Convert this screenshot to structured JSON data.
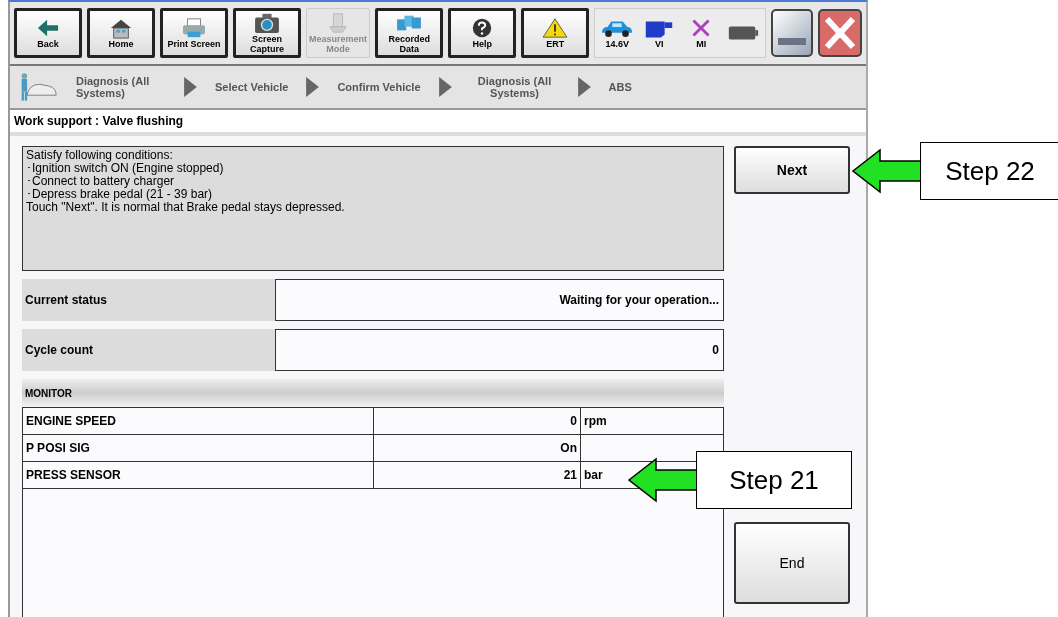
{
  "toolbar": {
    "buttons": [
      {
        "kind": "back",
        "label": "Back",
        "disabled": false
      },
      {
        "kind": "home",
        "label": "Home",
        "disabled": false
      },
      {
        "kind": "printer",
        "label": "Print Screen",
        "disabled": false
      },
      {
        "kind": "camera",
        "label": "Screen Capture",
        "disabled": false
      },
      {
        "kind": "meter",
        "label": "Measurement Mode",
        "disabled": true
      },
      {
        "kind": "folders",
        "label": "Recorded Data",
        "disabled": false
      },
      {
        "kind": "help",
        "label": "Help",
        "disabled": false
      },
      {
        "kind": "warning",
        "label": "ERT",
        "disabled": false
      }
    ],
    "status": [
      {
        "kind": "car",
        "label": "14.6V"
      },
      {
        "kind": "vi",
        "label": "VI"
      },
      {
        "kind": "mi",
        "label": "MI"
      },
      {
        "kind": "battery"
      }
    ]
  },
  "breadcrumb": [
    "Diagnosis (All Systems)",
    "Select Vehicle",
    "Confirm Vehicle",
    "Diagnosis (All Systems)",
    "ABS"
  ],
  "page_title": "Work support : Valve flushing",
  "instructions": [
    "Satisfy following conditions:",
    "･Ignition switch ON (Engine stopped)",
    "･Connect to battery charger",
    "･Depress brake pedal (21 - 39 bar)",
    "Touch \"Next\". It is normal that Brake pedal stays depressed."
  ],
  "fields": [
    {
      "label": "Current status",
      "value": "Waiting for your operation..."
    },
    {
      "label": "Cycle count",
      "value": "0"
    }
  ],
  "monitor": {
    "title": "MONITOR",
    "rows": [
      {
        "item": "ENGINE SPEED",
        "value": "0",
        "unit": "rpm"
      },
      {
        "item": "P POSI SIG",
        "value": "On",
        "unit": ""
      },
      {
        "item": "PRESS SENSOR",
        "value": "21",
        "unit": "bar"
      }
    ]
  },
  "buttons": {
    "next": "Next",
    "end": "End"
  },
  "callouts": [
    "Step 22",
    "Step 21"
  ]
}
